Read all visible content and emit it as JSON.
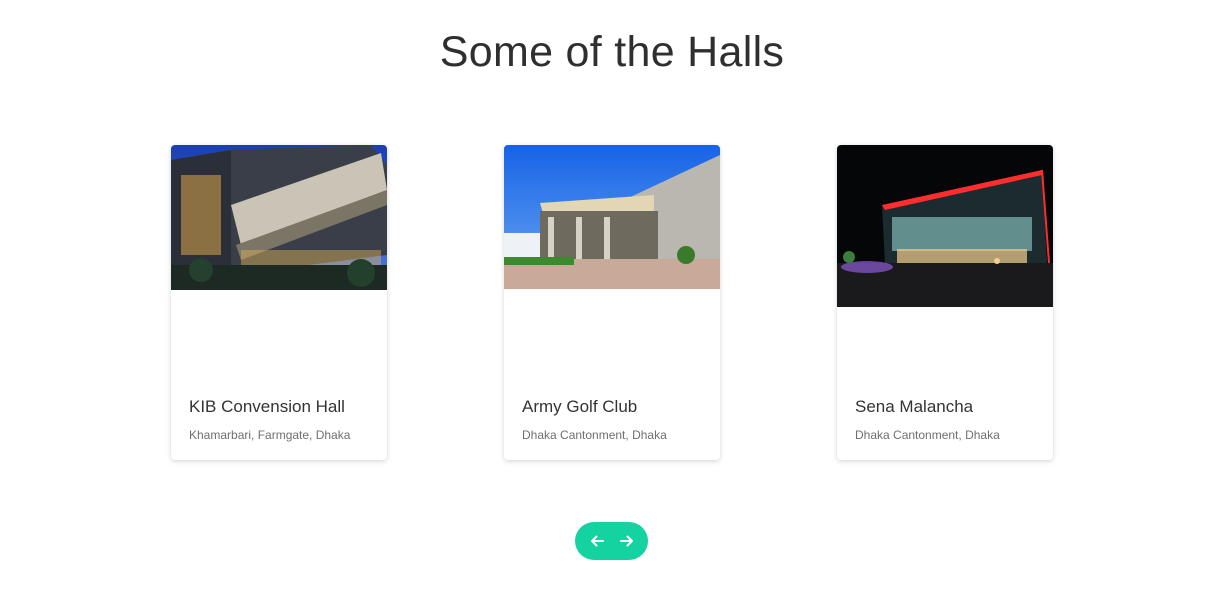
{
  "section": {
    "title": "Some of the Halls"
  },
  "halls": [
    {
      "name": "KIB Convension Hall",
      "location": "Khamarbari, Farmgate, Dhaka"
    },
    {
      "name": "Army Golf Club",
      "location": "Dhaka Cantonment, Dhaka"
    },
    {
      "name": "Sena Malancha",
      "location": "Dhaka Cantonment, Dhaka"
    }
  ],
  "carousel_nav": {
    "prev_icon": "arrow-left-icon",
    "next_icon": "arrow-right-icon",
    "color": "#14d3a0"
  }
}
